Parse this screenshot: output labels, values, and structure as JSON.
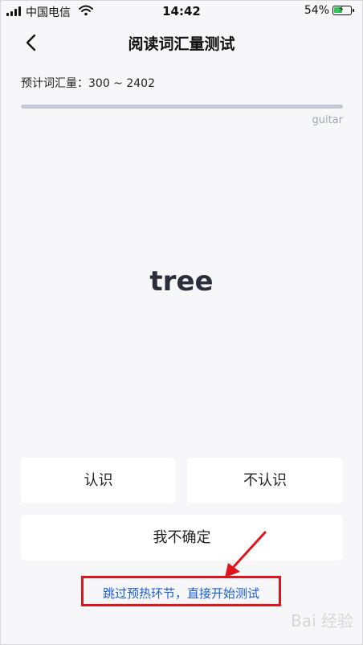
{
  "status_bar": {
    "carrier": "中国电信",
    "time": "14:42",
    "battery": "54%",
    "battery_level": 0.54
  },
  "nav": {
    "title": "阅读词汇量测试"
  },
  "estimate_text": "预计词汇量：300 ~ 2402",
  "progress": {
    "value": 1.0,
    "previous_word": "guitar"
  },
  "current_word": "tree",
  "buttons": {
    "know": "认识",
    "unknown": "不认识",
    "unsure": "我不确定"
  },
  "skip_link": "跳过预热环节，直接开始测试",
  "annotation": {
    "highlight_color": "#e0141b",
    "link_color": "#1a5bd8"
  },
  "watermark": "Bai 经验"
}
